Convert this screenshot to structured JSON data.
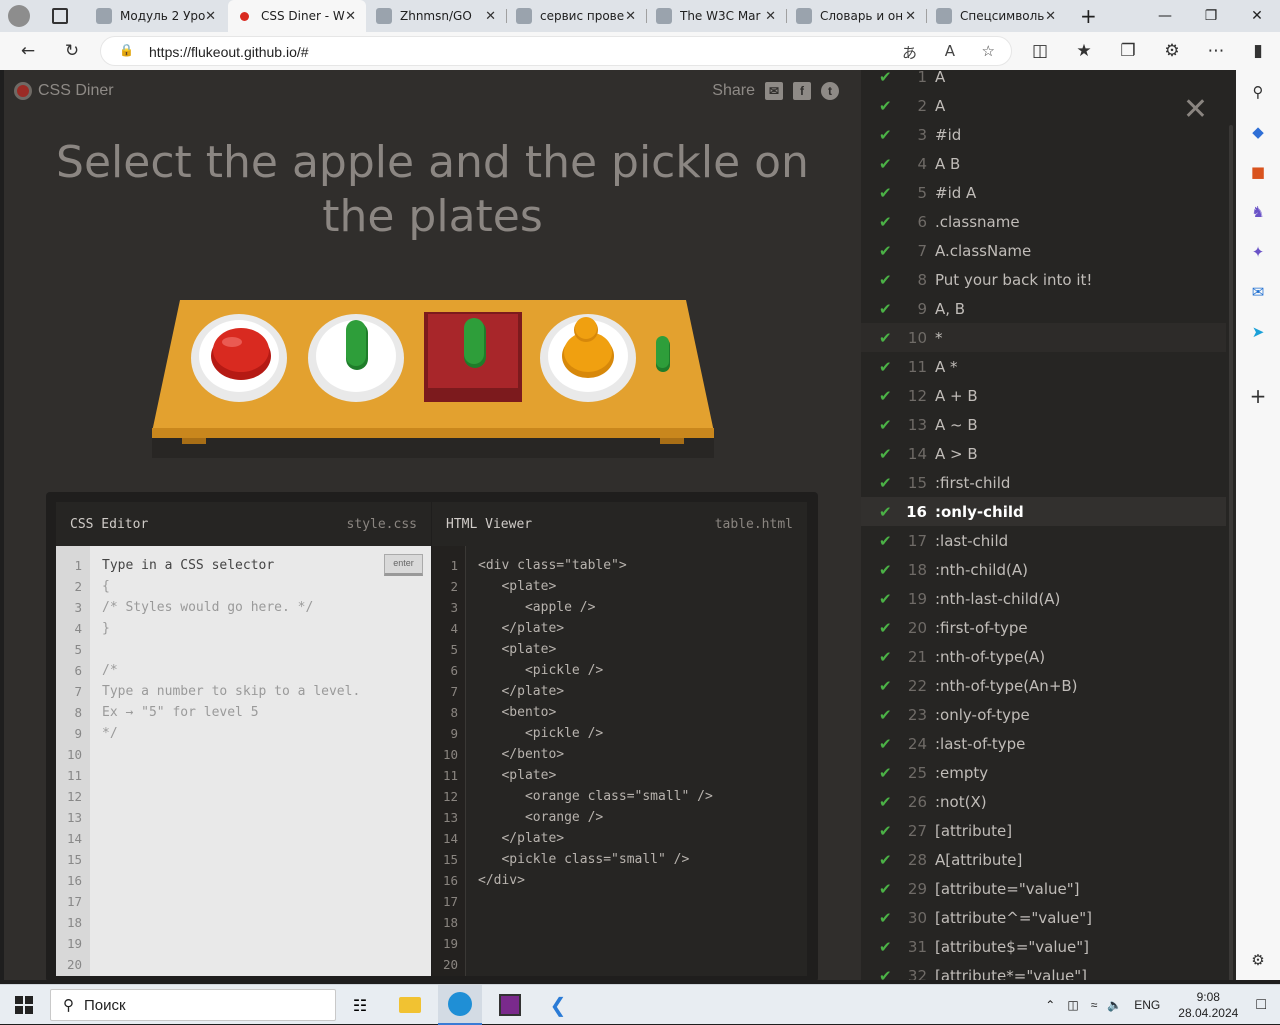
{
  "browser": {
    "tabs": [
      {
        "label": "Модуль 2 Уро",
        "icon": "edge-doc-icon"
      },
      {
        "label": "CSS Diner - W",
        "icon": "css-diner-icon",
        "active": true
      },
      {
        "label": "Zhnmsn/GO",
        "icon": "github-icon"
      },
      {
        "label": "сервис прове",
        "icon": "service-icon"
      },
      {
        "label": "The W3C Mar",
        "icon": "w3c-icon"
      },
      {
        "label": "Словарь и он",
        "icon": "dictionary-icon"
      },
      {
        "label": "Спецсимволь",
        "icon": "special-chars-icon"
      }
    ],
    "url": "https://flukeout.github.io/#"
  },
  "app": {
    "logo": "CSS Diner",
    "share": "Share",
    "order": "Select the apple and the pickle on the plates",
    "css_editor": {
      "title": "CSS Editor",
      "file": "style.css",
      "enter": "enter",
      "lines": [
        "Type in a CSS selector",
        "{",
        "/* Styles would go here. */",
        "}",
        "",
        "/*",
        "Type a number to skip to a level.",
        "Ex → \"5\" for level 5",
        "*/"
      ]
    },
    "html_viewer": {
      "title": "HTML Viewer",
      "file": "table.html",
      "lines": [
        "<div class=\"table\">",
        "   <plate>",
        "      <apple />",
        "   </plate>",
        "   <plate>",
        "      <pickle />",
        "   </plate>",
        "   <bento>",
        "      <pickle />",
        "   </bento>",
        "   <plate>",
        "      <orange class=\"small\" />",
        "      <orange />",
        "   </plate>",
        "   <pickle class=\"small\" />",
        "</div>"
      ]
    },
    "line_numbers": [
      "1",
      "2",
      "3",
      "4",
      "5",
      "6",
      "7",
      "8",
      "9",
      "10",
      "11",
      "12",
      "13",
      "14",
      "15",
      "16",
      "17",
      "18",
      "19",
      "20"
    ],
    "levels": [
      {
        "n": "1",
        "name": "A"
      },
      {
        "n": "2",
        "name": "A"
      },
      {
        "n": "3",
        "name": "#id"
      },
      {
        "n": "4",
        "name": "A  B"
      },
      {
        "n": "5",
        "name": "#id  A"
      },
      {
        "n": "6",
        "name": ".classname"
      },
      {
        "n": "7",
        "name": "A.className"
      },
      {
        "n": "8",
        "name": "Put your back into it!"
      },
      {
        "n": "9",
        "name": "A, B"
      },
      {
        "n": "10",
        "name": "*"
      },
      {
        "n": "11",
        "name": "A  *"
      },
      {
        "n": "12",
        "name": "A + B"
      },
      {
        "n": "13",
        "name": "A ~ B"
      },
      {
        "n": "14",
        "name": "A > B"
      },
      {
        "n": "15",
        "name": ":first-child"
      },
      {
        "n": "16",
        "name": ":only-child"
      },
      {
        "n": "17",
        "name": ":last-child"
      },
      {
        "n": "18",
        "name": ":nth-child(A)"
      },
      {
        "n": "19",
        "name": ":nth-last-child(A)"
      },
      {
        "n": "20",
        "name": ":first-of-type"
      },
      {
        "n": "21",
        "name": ":nth-of-type(A)"
      },
      {
        "n": "22",
        "name": ":nth-of-type(An+B)"
      },
      {
        "n": "23",
        "name": ":only-of-type"
      },
      {
        "n": "24",
        "name": ":last-of-type"
      },
      {
        "n": "25",
        "name": ":empty"
      },
      {
        "n": "26",
        "name": ":not(X)"
      },
      {
        "n": "27",
        "name": "[attribute]"
      },
      {
        "n": "28",
        "name": "A[attribute]"
      },
      {
        "n": "29",
        "name": "[attribute=\"value\"]"
      },
      {
        "n": "30",
        "name": "[attribute^=\"value\"]"
      },
      {
        "n": "31",
        "name": "[attribute$=\"value\"]"
      },
      {
        "n": "32",
        "name": "[attribute*=\"value\"]"
      }
    ],
    "current_level": "16"
  },
  "taskbar": {
    "search": "Поиск",
    "lang": "ENG",
    "time": "9:08",
    "date": "28.04.2024"
  },
  "colors": {
    "check": "#4bb246",
    "apple": "#d92a20",
    "pickle": "#2e9e3a",
    "orange": "#f0a010",
    "table": "#e3a12f",
    "bento": "#a8262a"
  }
}
